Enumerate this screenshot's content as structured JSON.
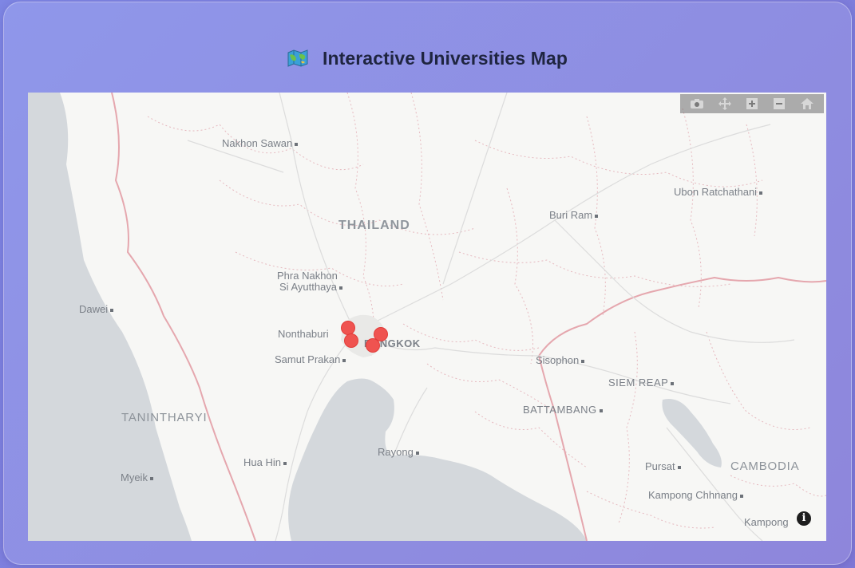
{
  "header": {
    "title": "Interactive Universities Map",
    "icon": "world-map-icon"
  },
  "map": {
    "basemap": "light",
    "labels": {
      "nakhon_sawan": "Nakhon Sawan",
      "ubon": "Ubon Ratchathani",
      "thailand": "THAILAND",
      "buri_ram": "Buri Ram",
      "phra_nakhon_1": "Phra Nakhon",
      "phra_nakhon_2": "Si Ayutthaya",
      "dawei": "Dawei",
      "nonthaburi": "Nonthaburi",
      "bangkok": "BANGKOK",
      "samut_prakan": "Samut Prakan",
      "sisophon": "Sisophon",
      "siem_reap": "SIEM REAP",
      "battambang": "BATTAMBANG",
      "tanintharyi": "TANINTHARYI",
      "hua_hin": "Hua Hin",
      "rayong": "Rayong",
      "myeik": "Myeik",
      "pursat": "Pursat",
      "cambodia": "CAMBODIA",
      "kampong_chhnang": "Kampong Chhnang",
      "kampong": "Kampong"
    },
    "marker_color": "#ef5350",
    "marker_count": 4
  },
  "modebar": {
    "buttons": [
      "camera-icon",
      "pan-icon",
      "zoom-in-icon",
      "zoom-out-icon",
      "home-icon"
    ]
  },
  "attribution_icon": "info-icon"
}
